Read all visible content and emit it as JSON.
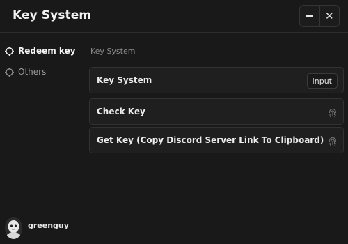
{
  "window": {
    "title": "Key System",
    "controls": {
      "minimize_icon": "minimize-icon",
      "close_icon": "close-icon",
      "close_glyph": "✕"
    }
  },
  "sidebar": {
    "items": [
      {
        "label": "Redeem key",
        "icon": "crosshair-icon",
        "active": true
      },
      {
        "label": "Others",
        "icon": "crosshair-icon",
        "active": false
      }
    ],
    "user": {
      "name": "greenguy",
      "avatar_icon": "avatar-icon"
    }
  },
  "main": {
    "section_title": "Key System",
    "rows": [
      {
        "label": "Key System",
        "control": "Input"
      },
      {
        "label": "Check Key",
        "icon": "fingerprint-icon"
      },
      {
        "label": "Get Key (Copy Discord Server Link To Clipboard)",
        "icon": "fingerprint-icon"
      }
    ]
  }
}
